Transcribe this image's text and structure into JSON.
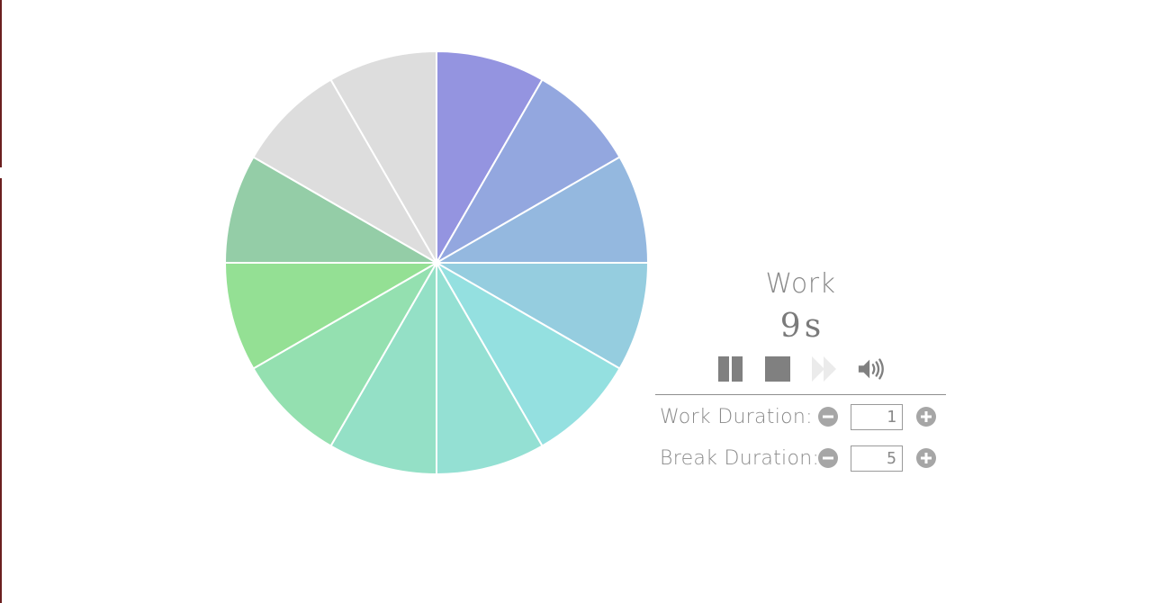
{
  "wheel": {
    "segments_total": 12,
    "segment_colors": [
      "#9494e0",
      "#93a7df",
      "#94b8df",
      "#95cddf",
      "#94e0e0",
      "#94e0d3",
      "#94e0c6",
      "#94e0b0",
      "#94e094",
      "#94cda7",
      "#dddddd",
      "#dddddd"
    ],
    "separator_color": "#ffffff"
  },
  "timer": {
    "phase": "Work",
    "value": "9",
    "unit": "s"
  },
  "controls": {
    "pause_icon": "pause-icon",
    "stop_icon": "stop-icon",
    "skip_icon": "fast-forward-icon",
    "volume_icon": "volume-icon",
    "icon_color": "#808080",
    "disabled_color": "#ebebeb"
  },
  "settings": {
    "work_label": "Work Duration:",
    "work_value": "1",
    "break_label": "Break Duration:",
    "break_value": "5"
  },
  "colors": {
    "text": "#8a8a8a",
    "button_gray": "#a6a6a6",
    "left_border": "#6b1f1f"
  }
}
